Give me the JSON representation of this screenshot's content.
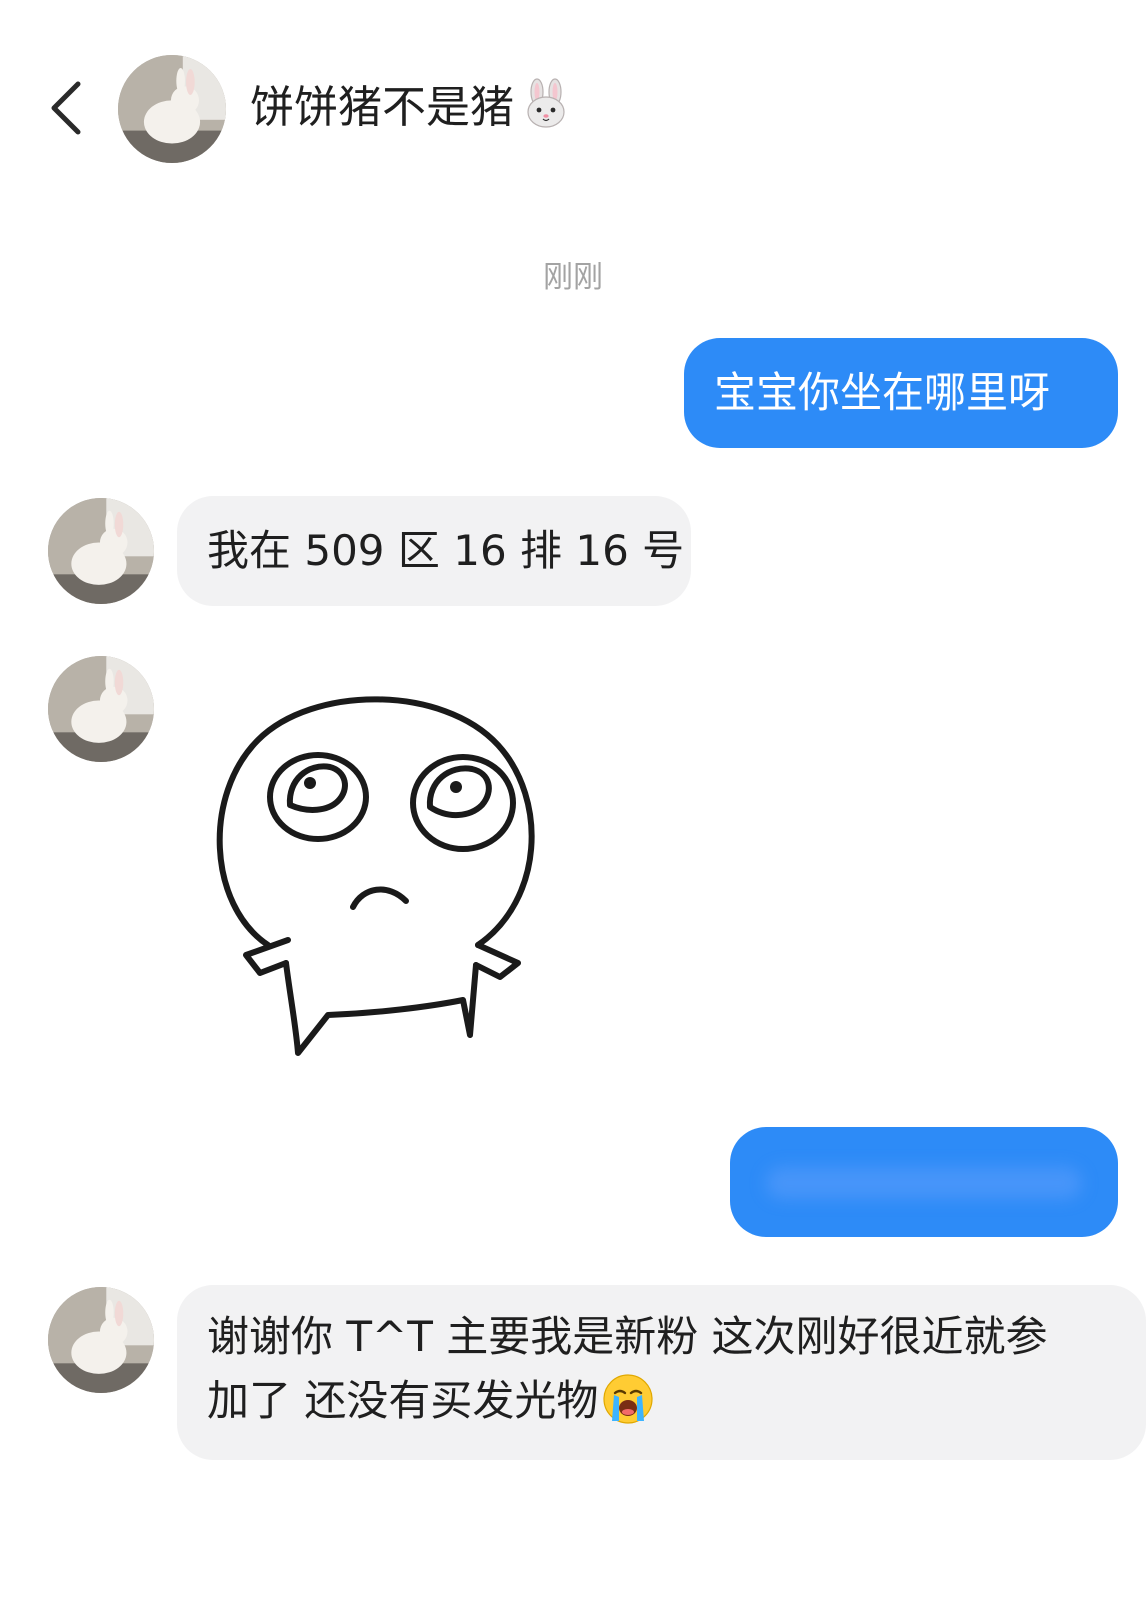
{
  "header": {
    "back_icon": "chevron-left-icon",
    "avatar_icon": "rabbit-photo",
    "contact_name": "饼饼猪不是猪",
    "name_emoji": "rabbit-face-emoji"
  },
  "timestamp": "刚刚",
  "messages": [
    {
      "direction": "outgoing",
      "type": "text",
      "text": "宝宝你坐在哪里呀"
    },
    {
      "direction": "incoming",
      "type": "text",
      "text": "我在 509 区 16 排 16 号"
    },
    {
      "direction": "incoming",
      "type": "sticker",
      "sticker": "pleading-doodle-face"
    },
    {
      "direction": "outgoing",
      "type": "text",
      "text": ""
    },
    {
      "direction": "incoming",
      "type": "text",
      "lines": [
        "谢谢你 T^T 主要我是新粉 这次刚好很近就参",
        "加了 还没有买发光物"
      ],
      "trailing_emoji": "loudly-crying-face-emoji"
    }
  ],
  "colors": {
    "outgoing_bubble": "#2d8bf7",
    "incoming_bubble": "#f2f2f3",
    "timestamp_text": "#a3a3a3",
    "background": "#ffffff"
  }
}
